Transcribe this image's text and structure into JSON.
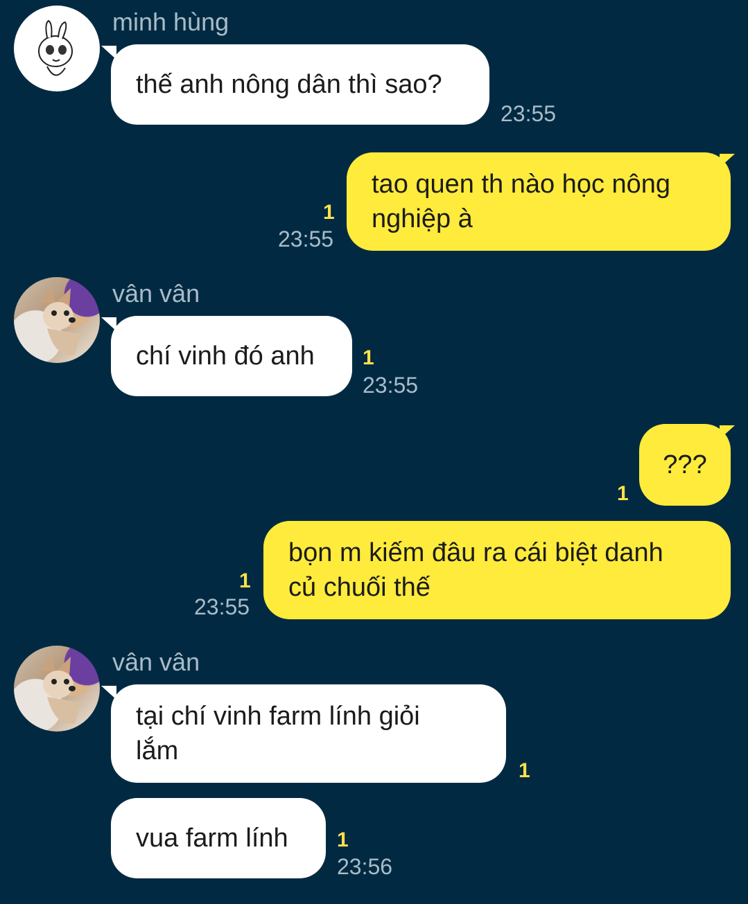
{
  "messages": [
    {
      "sender": "minh hùng",
      "text": "thế anh nông dân thì sao?",
      "time": "23:55"
    },
    {
      "text_line1": "tao quen th nào học nông",
      "text_line2": "nghiệp à",
      "unread": "1",
      "time": "23:55"
    },
    {
      "sender": "vân vân",
      "text": "chí vinh đó anh",
      "unread": "1",
      "time": "23:55"
    },
    {
      "text": "???",
      "unread": "1"
    },
    {
      "text_line1": "bọn m kiếm đâu ra cái biệt danh",
      "text_line2": "củ chuối thế",
      "unread": "1",
      "time": "23:55"
    },
    {
      "sender": "vân vân",
      "text_line1": "tại chí vinh farm lính giỏi",
      "text_line2": "lắm",
      "unread": "1"
    },
    {
      "text": "vua farm lính",
      "unread": "1",
      "time": "23:56"
    }
  ],
  "colors": {
    "background": "#012a42",
    "incoming_bubble": "#ffffff",
    "outgoing_bubble": "#ffeb3b",
    "unread": "#ffe14a",
    "meta_text": "#a9bcc8"
  },
  "icons": {
    "avatar_minh_hung": "bunny-avatar",
    "avatar_van_van": "dog-avatar"
  }
}
